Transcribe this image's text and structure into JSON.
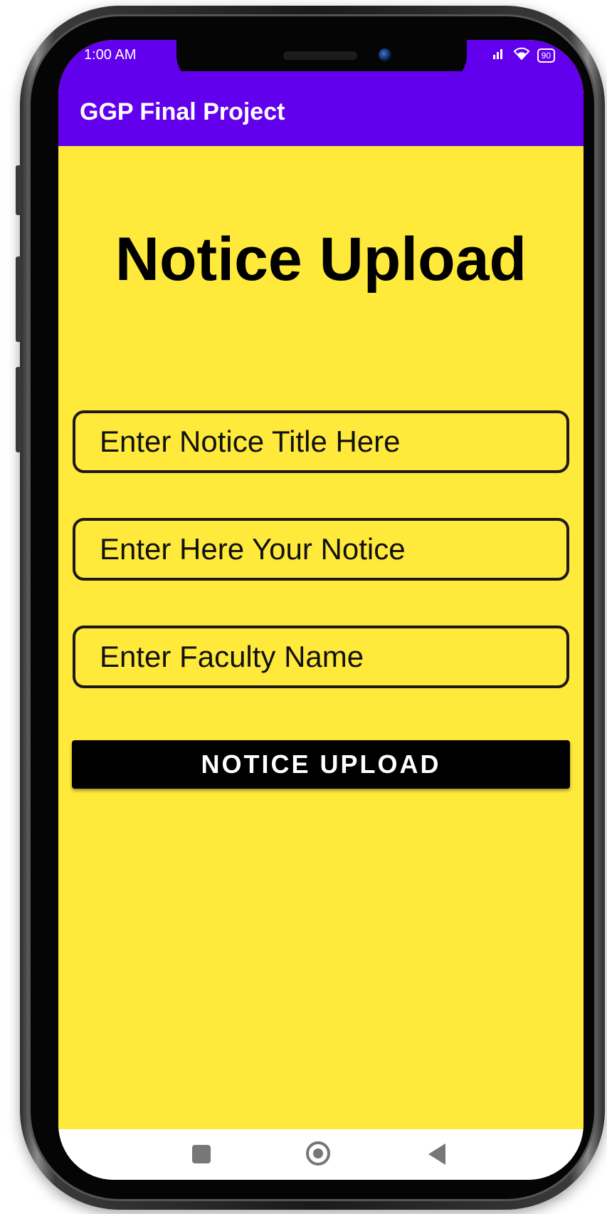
{
  "status_bar": {
    "time": "1:00 AM",
    "battery": "90",
    "icons": [
      "bell-muted-icon",
      "signal-icon",
      "wifi-icon",
      "battery-icon"
    ]
  },
  "app_bar": {
    "title": "GGP Final Project"
  },
  "page": {
    "heading": "Notice Upload",
    "fields": {
      "notice_title_placeholder": "Enter Notice Title Here",
      "notice_body_placeholder": "Enter Here Your Notice",
      "faculty_name_placeholder": "Enter Faculty Name"
    },
    "upload_button_label": "NOTICE UPLOAD"
  },
  "nav_bar": {
    "icons": [
      "recents-icon",
      "home-icon",
      "back-icon"
    ]
  },
  "colors": {
    "app_bar": "#6200ee",
    "background": "#ffe93b",
    "button": "#000000"
  }
}
